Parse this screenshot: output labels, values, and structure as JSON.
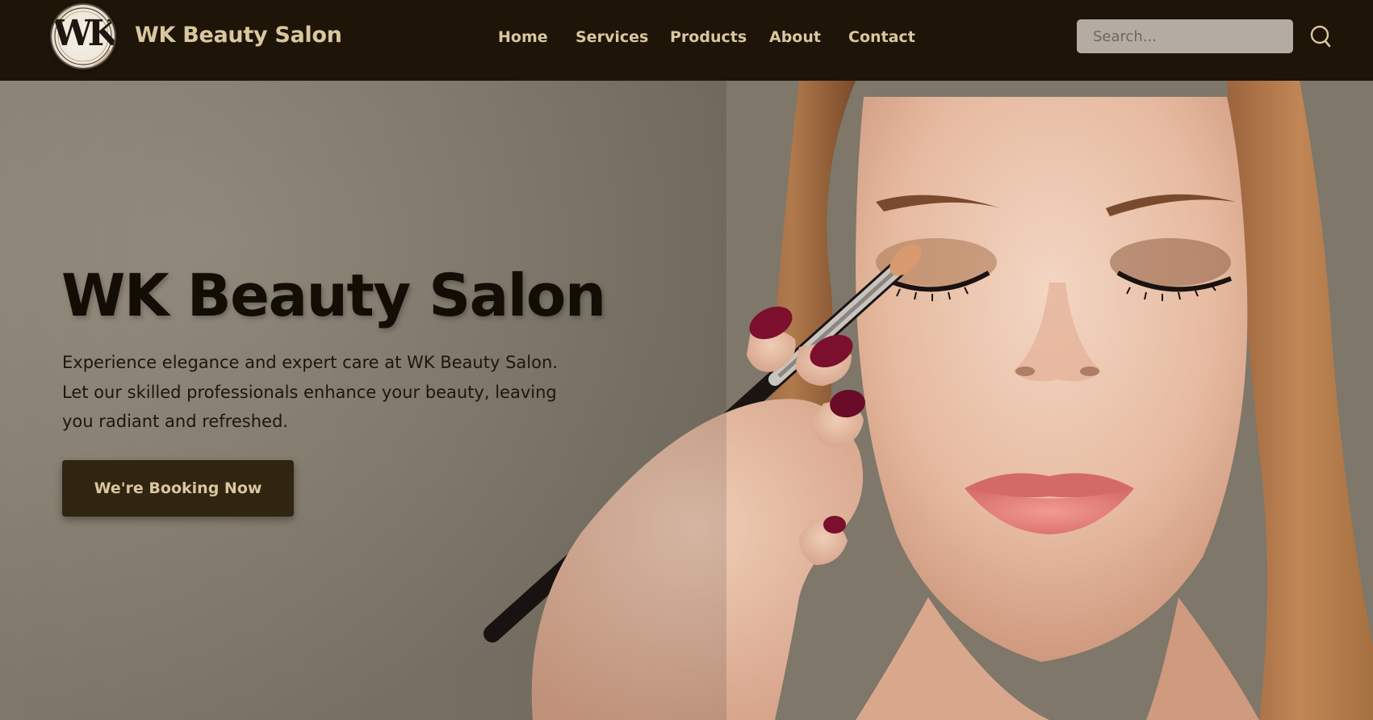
{
  "header": {
    "brand": "WK Beauty Salon",
    "logo_monogram": "WK",
    "logo_script": "Beauty Salon",
    "nav": [
      {
        "label": "Home"
      },
      {
        "label": "Services"
      },
      {
        "label": "Products"
      },
      {
        "label": "About"
      },
      {
        "label": "Contact"
      }
    ],
    "search": {
      "placeholder": "Search...",
      "value": "",
      "icon": "search-icon"
    }
  },
  "hero": {
    "title": "WK Beauty Salon",
    "description": "Experience elegance and expert care at WK Beauty Salon. Let our skilled professionals enhance your beauty, leaving you radiant and refreshed.",
    "cta_label": "We're Booking Now",
    "image": "woman-applying-eye-makeup-photo"
  },
  "colors": {
    "header_bg": "#1e1408",
    "accent_text": "#d9c79e",
    "button_bg": "#2f2511",
    "search_bg": "#b4aca2"
  }
}
